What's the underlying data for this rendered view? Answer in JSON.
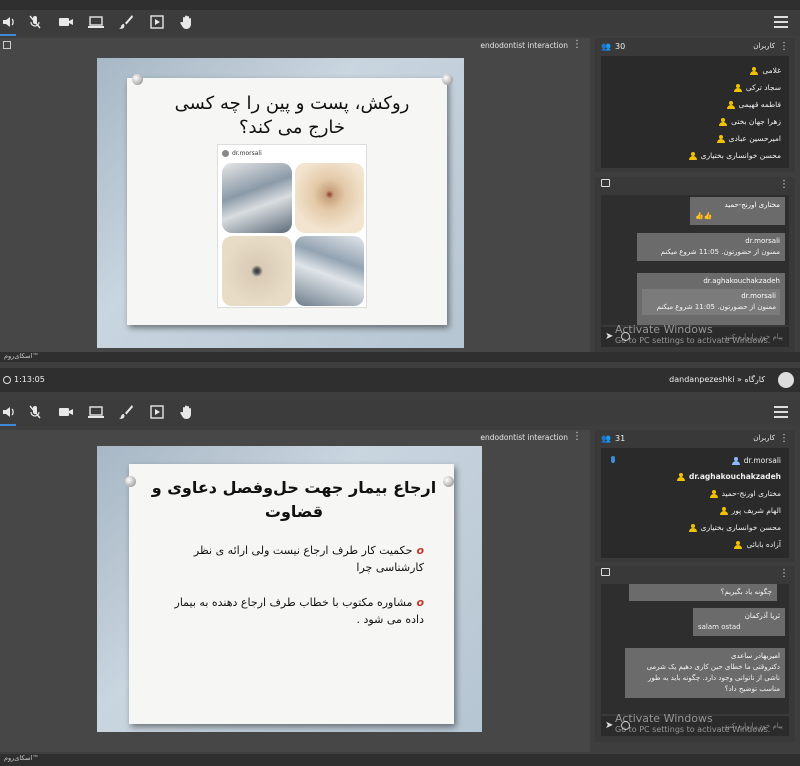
{
  "screens": [
    {
      "toolbar": {
        "icons": [
          "speaker-icon",
          "mic-off-icon",
          "camera-icon",
          "screen-share-icon",
          "brush-icon",
          "media-icon",
          "hand-icon"
        ]
      },
      "content_title": "endodontist interaction",
      "slide": {
        "title": "روکش، پست و پین را چه کسی خارج می کند؟",
        "instagram_user": "dr.morsali"
      },
      "users": {
        "count": "30",
        "title": "کاربران",
        "list": [
          "غلامی",
          "سجاد ترکی",
          "فاطمه قهیمی",
          "زهرا جهان بختی",
          "امیرحسین عبادی",
          "محسن خوانساری بختیاری"
        ]
      },
      "chat": {
        "messages": [
          {
            "name": "مختاری اورنج-حمید",
            "text": "👍👍"
          },
          {
            "name": "dr.morsali",
            "text": "ممنون از حضورتون. 11:05 شروع میکنم"
          },
          {
            "name": "dr.aghakouchakzadeh",
            "quote_name": "dr.morsali",
            "quote_text": "ممنون از حضورتون. 11:05 شروع میکنم"
          }
        ],
        "placeholder": "پیام خود را وارد کنید",
        "watermark_title": "Activate Windows",
        "watermark_sub": "Go to PC settings to activate Windows."
      },
      "status_text": "اسکای‌روم™"
    },
    {
      "topbar": {
        "time": "1:13:05",
        "breadcrumb": "dandanpezeshki » کارگاه"
      },
      "toolbar": {
        "icons": [
          "speaker-icon",
          "mic-off-icon",
          "camera-icon",
          "screen-share-icon",
          "brush-icon",
          "media-icon",
          "hand-icon"
        ]
      },
      "content_title": "endodontist interaction",
      "slide": {
        "title": "ارجاع بیمار جهت حل‌وفصل دعاوی و قضاوت",
        "bullets": [
          "حکمیت کار طرف ارجاع نیست ولی ارائه ی نظر کارشناسی چرا",
          "مشاوره مکتوب با خطاب طرف ارجاع دهنده به بیمار داده می شود ."
        ]
      },
      "users": {
        "count": "31",
        "title": "کاربران",
        "list": [
          "dr.morsali",
          "dr.aghakouchakzadeh",
          "مختاری اورنج-حمید",
          "الهام شریف پور",
          "محسن خوانساری بختیاری",
          "آزاده بابائی"
        ]
      },
      "chat": {
        "messages": [
          {
            "name": "",
            "text": "چگونه یاد بگیریم؟"
          },
          {
            "name": "ثریا آذرکمان",
            "text": "salam ostad"
          },
          {
            "name": "امیربهادر ساعدی",
            "text": "دکتروقتی ما خطای حین کاری دهیم یک شرمی ناشی از ناتوانی وجود دارد. چگونه باید به طور مناسب توضیح داد؟"
          }
        ],
        "placeholder": "پیام خود را وارد کنید",
        "watermark_title": "Activate Windows",
        "watermark_sub": "Go to PC settings to activate Windows."
      },
      "status_text": "اسکای‌روم™"
    }
  ],
  "colors": {
    "accent": "#3d8bd8",
    "user_icon": "#f2c200",
    "panel_bg": "#2a2a2a"
  }
}
